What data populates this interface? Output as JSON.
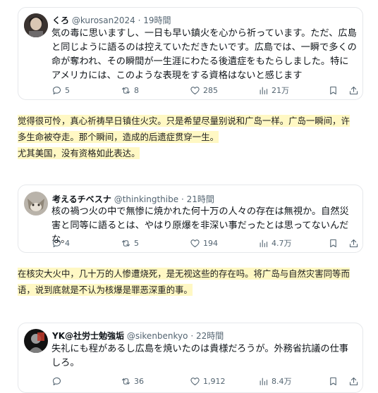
{
  "tweets": [
    {
      "display_name": "くろ",
      "handle": "@kurosan2024",
      "time": "19時間",
      "text": "気の毒に思いますし、一日も早い鎮火を心から祈っています。ただ、広島と同じように語るのは控えていただきたいです。広島では、一瞬で多くの命が奪われ、その瞬間が一生涯にわたる後遺症をもたらしました。特にアメリカには、このような表現をする資格はないと感じます",
      "replies": "5",
      "reposts": "8",
      "likes": "285",
      "views": "21万"
    },
    {
      "display_name": "考えるチベスナ",
      "handle": "@thinkingthibe",
      "time": "21時間",
      "text": "核の禍つ火の中で無惨に焼かれた何十万の人々の存在は無視か。自然災害と同等に語るとは、やはり原爆を非深い事だったとは思ってないんだな。",
      "replies": "4",
      "reposts": "5",
      "likes": "194",
      "views": "4.7万"
    },
    {
      "display_name": "YK@社労士勉強垢",
      "handle": "@sikenbenkyo",
      "time": "22時間",
      "text": "失礼にも程があるし広島を焼いたのは貴様だろうが。外務省抗議の仕事しろ。",
      "replies": "",
      "reposts": "36",
      "likes": "1,912",
      "views": "8.4万"
    }
  ],
  "translations": [
    {
      "lines": [
        "觉得很可怜，真心祈祷早日镇住火灾。只是希望尽量别说和广岛一样。广岛一瞬间，许",
        "多生命被夺走。那个瞬间，造成的后遗症贯穿一生。",
        "尤其美国，没有资格如此表达。"
      ]
    },
    {
      "lines": [
        "在核灾大火中，几十万的人惨遭烧死，是无视这些的存在吗。将广岛与自然灾害同等而",
        "语，说到底就是不认为核爆是罪恶深重的事。"
      ]
    }
  ],
  "icons": [
    "reply-icon",
    "repost-icon",
    "like-icon",
    "views-icon",
    "bookmark-icon",
    "share-icon"
  ],
  "colors": {
    "highlight": "#fff8c4",
    "meta_text": "#536471",
    "card_border": "#e6e8eb"
  }
}
